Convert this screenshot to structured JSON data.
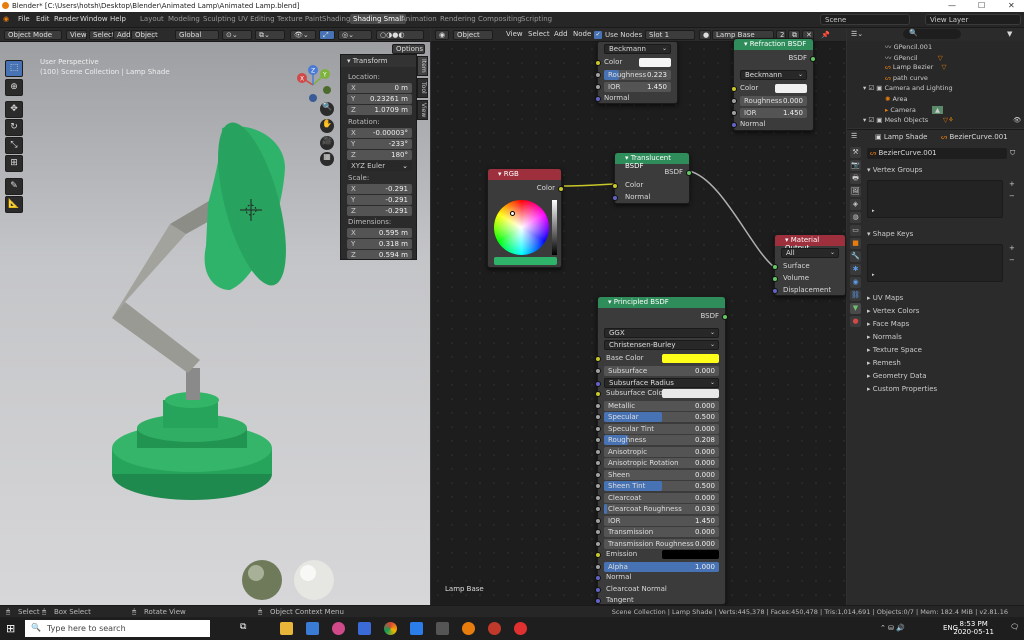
{
  "window": {
    "title": "Blender* [C:\\Users\\hotsh\\Desktop\\Blender\\Animated Lamp\\Animated Lamp.blend]"
  },
  "menu": [
    "File",
    "Edit",
    "Render",
    "Window",
    "Help"
  ],
  "workspaces": [
    "Layout",
    "Modeling",
    "Sculpting",
    "UV Editing",
    "Texture Paint",
    "Shading",
    "Shading Small",
    "Animation",
    "Rendering",
    "Compositing",
    "Scripting"
  ],
  "active_workspace": "Shading Small",
  "scene": "Scene",
  "view_layer": "View Layer",
  "viewport": {
    "mode": "Object Mode",
    "menus": [
      "View",
      "Select",
      "Add",
      "Object"
    ],
    "orientation": "Global",
    "options": "Options",
    "info_line1": "User Perspective",
    "info_line2": "(100) Scene Collection | Lamp Shade",
    "transform": {
      "title": "Transform",
      "location_label": "Location:",
      "loc_x": "0 m",
      "loc_y": "0.23261 m",
      "loc_z": "1.0709 m",
      "rotation_label": "Rotation:",
      "rot_x": "-0.00003°",
      "rot_y": "-233°",
      "rot_z": "180°",
      "rot_mode": "XYZ Euler",
      "scale_label": "Scale:",
      "scale_x": "-0.291",
      "scale_y": "-0.291",
      "scale_z": "-0.291",
      "dim_label": "Dimensions:",
      "dim_x": "0.595 m",
      "dim_y": "0.318 m",
      "dim_z": "0.594 m"
    },
    "tabs": [
      "Item",
      "Tool",
      "View"
    ],
    "axes": {
      "x": "X",
      "y": "Y",
      "z": "Z"
    }
  },
  "node_editor": {
    "header": [
      "Object",
      "View",
      "Select",
      "Add",
      "Node"
    ],
    "use_nodes": "Use Nodes",
    "slot": "Slot 1",
    "material": "Lamp Base",
    "users": "2",
    "frame_label": "Lamp Base",
    "glass": {
      "dist": "Beckmann",
      "color": "Color",
      "roughness_label": "Roughness",
      "roughness": "0.223",
      "ior_label": "IOR",
      "ior": "1.450",
      "normal": "Normal"
    },
    "refraction": {
      "title": "Refraction BSDF",
      "out": "BSDF",
      "dist": "Beckmann",
      "color": "Color",
      "roughness_label": "Roughness",
      "roughness": "0.000",
      "ior_label": "IOR",
      "ior": "1.450",
      "normal": "Normal"
    },
    "rgb": {
      "title": "RGB",
      "out": "Color",
      "swatch": "#2fb36a"
    },
    "translucent": {
      "title": "Translucent BSDF",
      "out": "BSDF",
      "color": "Color",
      "normal": "Normal"
    },
    "output": {
      "title": "Material Output",
      "target": "All",
      "surface": "Surface",
      "volume": "Volume",
      "displacement": "Displacement"
    },
    "principled": {
      "title": "Principled BSDF",
      "out": "BSDF",
      "dist": "GGX",
      "sss": "Christensen-Burley",
      "base_color_label": "Base Color",
      "base_color": "#ffff1a",
      "rows": [
        {
          "label": "Subsurface",
          "value": "0.000",
          "fill": 0
        },
        {
          "label": "Subsurface Radius",
          "value": "",
          "fill": 0,
          "dropdown": true
        },
        {
          "label": "Subsurface Color",
          "value": "",
          "fill": 0,
          "swatch": "#e8e8e8"
        },
        {
          "label": "Metallic",
          "value": "0.000",
          "fill": 0
        },
        {
          "label": "Specular",
          "value": "0.500",
          "fill": 0.5
        },
        {
          "label": "Specular Tint",
          "value": "0.000",
          "fill": 0
        },
        {
          "label": "Roughness",
          "value": "0.208",
          "fill": 0.208
        },
        {
          "label": "Anisotropic",
          "value": "0.000",
          "fill": 0
        },
        {
          "label": "Anisotropic Rotation",
          "value": "0.000",
          "fill": 0
        },
        {
          "label": "Sheen",
          "value": "0.000",
          "fill": 0
        },
        {
          "label": "Sheen Tint",
          "value": "0.500",
          "fill": 0.5
        },
        {
          "label": "Clearcoat",
          "value": "0.000",
          "fill": 0
        },
        {
          "label": "Clearcoat Roughness",
          "value": "0.030",
          "fill": 0.03
        },
        {
          "label": "IOR",
          "value": "1.450",
          "fill": 0
        },
        {
          "label": "Transmission",
          "value": "0.000",
          "fill": 0
        },
        {
          "label": "Transmission Roughness",
          "value": "0.000",
          "fill": 0
        },
        {
          "label": "Emission",
          "value": "",
          "fill": 0,
          "swatch": "#000000"
        },
        {
          "label": "Alpha",
          "value": "1.000",
          "fill": 1
        }
      ],
      "normal": "Normal",
      "clearcoat_normal": "Clearcoat Normal",
      "tangent": "Tangent"
    }
  },
  "outliner": {
    "items": [
      "GPencil.001",
      "GPencil",
      "Lamp Bezier",
      "path curve",
      "Camera and Lighting",
      "Area",
      "Camera",
      "Mesh Objects"
    ]
  },
  "properties": {
    "object": "Lamp Shade",
    "data": "BezierCurve.001",
    "datablock": "BezierCurve.001",
    "vertex_groups": "Vertex Groups",
    "shape_keys": "Shape Keys",
    "sections": [
      "UV Maps",
      "Vertex Colors",
      "Face Maps",
      "Normals",
      "Texture Space",
      "Remesh",
      "Geometry Data",
      "Custom Properties"
    ]
  },
  "status": {
    "select": "Select",
    "box_select": "Box Select",
    "rotate": "Rotate View",
    "context": "Object Context Menu",
    "info": "Scene Collection | Lamp Shade | Verts:445,378 | Faces:450,478 | Tris:1,014,691 | Objects:0/7 | Mem: 182.4 MiB | v2.81.16"
  },
  "taskbar": {
    "search": "Type here to search",
    "lang": "ENG",
    "time": "8:53 PM",
    "date": "2020-05-11"
  }
}
